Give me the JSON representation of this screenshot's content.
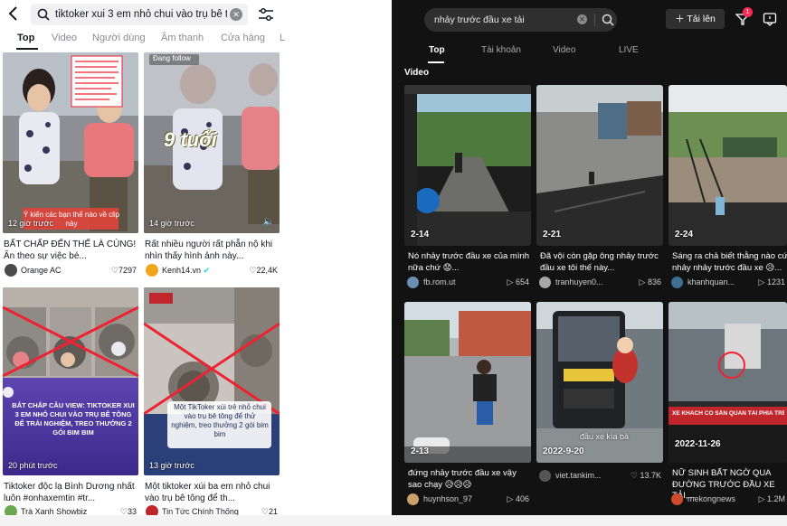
{
  "left_panel": {
    "search": {
      "query": "tiktoker xui 3 em nhỏ chui vào trụ bê tông"
    },
    "tabs": [
      "Top",
      "Video",
      "Người dùng",
      "Âm thanh",
      "Cửa hàng",
      "L"
    ],
    "cards": [
      {
        "overlay_label": "Ý kiến các bạn thế nào về clip này",
        "time": "12 giờ trước",
        "caption": "BẤT CHẤP ĐẾN THẾ LÀ CÙNG! Ăn theo sự việc bé...",
        "author": "Orange AC",
        "likes": "7297"
      },
      {
        "overlay_label": "Đang follow",
        "big_text": "9 tuổi",
        "time": "14 giờ trước",
        "caption": "Rất nhiều người rất phẫn nộ khi nhìn thấy hình ảnh này...",
        "author": "Kenh14.vn",
        "likes": "22,4K"
      },
      {
        "overlay_label": "BẮT CHẤP CÂU VIEW: TIKTOKER XUI 3 EM NHỎ CHUI VÀO TRỤ BÊ TÔNG ĐỂ TRẢI NGHIỆM, TREO THƯỞNG 2 GÓI BIM BIM",
        "time": "20 phút trước",
        "caption": "Tiktoker độc lạ Bình Dương nhất luôn #onhaxemtin #tr...",
        "author": "Trà Xanh Showbiz",
        "likes": "33"
      },
      {
        "overlay_label": "Một TikToker xúi trẻ nhỏ chui vào trụ bê tông để thử nghiệm, treo thưởng 2 gói bim bim",
        "time": "13 giờ trước",
        "caption": "Một tiktoker xúi ba em nhỏ chui vào trụ bê tông để th...",
        "author": "Tin Tức Chính Thống",
        "likes": "21"
      }
    ]
  },
  "right_panel": {
    "search": {
      "query": "nhảy trước đầu xe tải"
    },
    "upload_label": "Tải lên",
    "inbox_badge": "1",
    "tabs": [
      "Top",
      "Tài khoản",
      "Video",
      "LIVE"
    ],
    "section_title": "Video",
    "cards": [
      {
        "date": "2-14",
        "caption": "Nó nhảy trước đầu xe của mình nữa chứ 😟...",
        "author": "fb.rom.ut",
        "views": "654"
      },
      {
        "date": "2-21",
        "caption": "Đã vội còn gặp ông nhảy trước đầu xe tôi thế này...",
        "author": "tranhuyen0...",
        "views": "836"
      },
      {
        "date": "2-24",
        "caption": "Sáng ra chả biết thằng nào cứ nhảy nhảy trước đầu xe 😥...",
        "author": "khanhquan...",
        "views": "1231"
      },
      {
        "date": "2-13",
        "caption": "đứng nhảy trước đầu xe vậy sao chạy 😥😥😥",
        "author": "huynhson_97",
        "views": "406"
      },
      {
        "date": "2022-9-20",
        "overlay_label": "đầu xe kìa bà",
        "caption": "",
        "author": "viet.tankim...",
        "views": "13.7K"
      },
      {
        "date": "2022-11-26",
        "overlay_label": "XE KHÁCH CỐ SẮN QUAN TÀI PHÍA TRÊN",
        "caption": "NỮ SINH BẤT NGỜ QUA ĐƯỜNG TRƯỚC ĐẦU XE TẢI,...",
        "author": "mekongnews",
        "views": "1.2M"
      }
    ]
  },
  "colors": {
    "accent": "#fe2c55",
    "dark_bg": "#121212"
  }
}
